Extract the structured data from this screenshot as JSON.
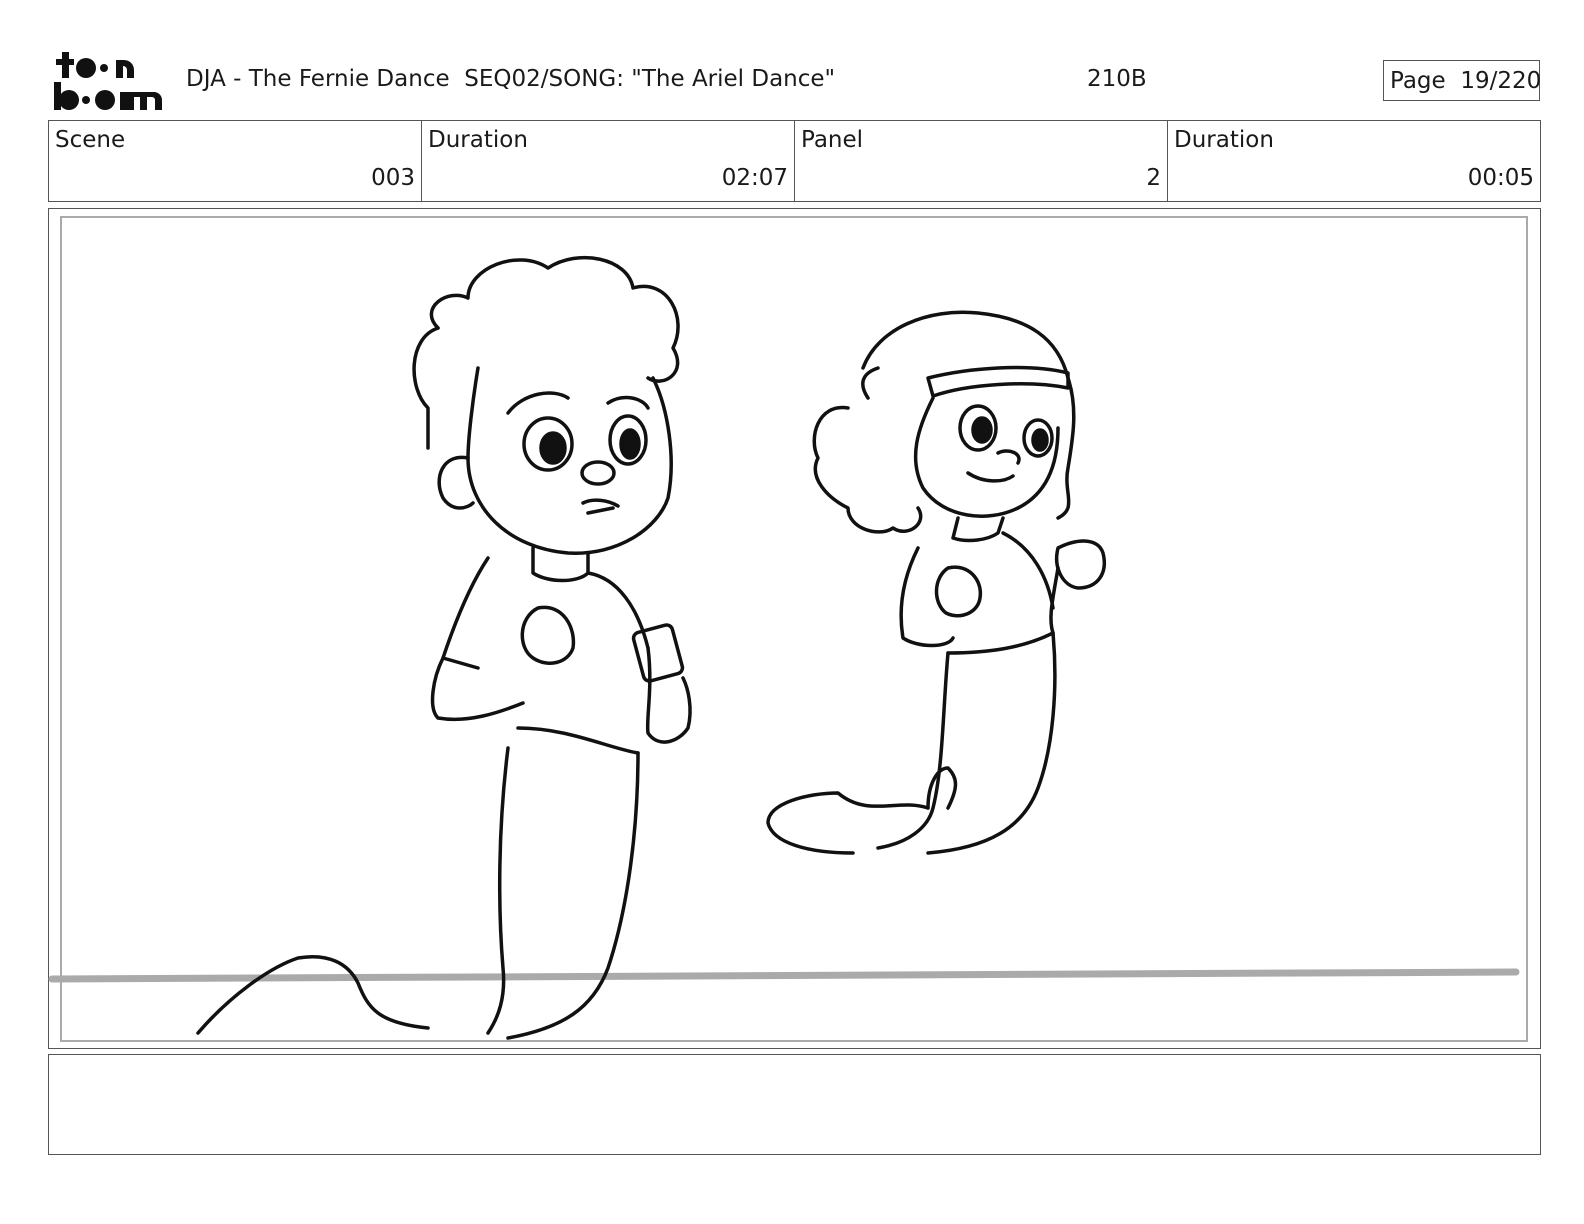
{
  "header": {
    "project_title": "DJA - The Fernie Dance  SEQ02/SONG: \"The Ariel Dance\"",
    "sheet_id": "210B",
    "page_label": "Page",
    "page_number": "19/220"
  },
  "logo": {
    "line1": "toon",
    "line2": "boom",
    "icon": "toon-boom-logo"
  },
  "info": {
    "scene_label": "Scene",
    "scene_value": "003",
    "scene_duration_label": "Duration",
    "scene_duration_value": "02:07",
    "panel_label": "Panel",
    "panel_value": "2",
    "panel_duration_label": "Duration",
    "panel_duration_value": "00:05"
  },
  "panel_image": {
    "description_icon": "storyboard-sketch-two-merkids"
  },
  "notes": {
    "text": ""
  }
}
